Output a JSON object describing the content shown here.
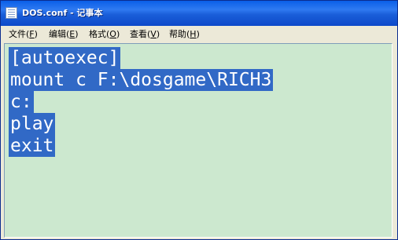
{
  "window": {
    "title": "DOS.conf - 记事本"
  },
  "menu": [
    {
      "label_pre": "文件(",
      "acc": "F",
      "label_post": ")"
    },
    {
      "label_pre": "编辑(",
      "acc": "E",
      "label_post": ")"
    },
    {
      "label_pre": "格式(",
      "acc": "O",
      "label_post": ")"
    },
    {
      "label_pre": "查看(",
      "acc": "V",
      "label_post": ")"
    },
    {
      "label_pre": "帮助(",
      "acc": "H",
      "label_post": ")"
    }
  ],
  "editor": {
    "lines": [
      "[autoexec]",
      "mount c F:\\dosgame\\RICH3",
      "c:",
      "play",
      "exit"
    ],
    "selection_color": "#3169c6",
    "background_color": "#cce8cf"
  }
}
